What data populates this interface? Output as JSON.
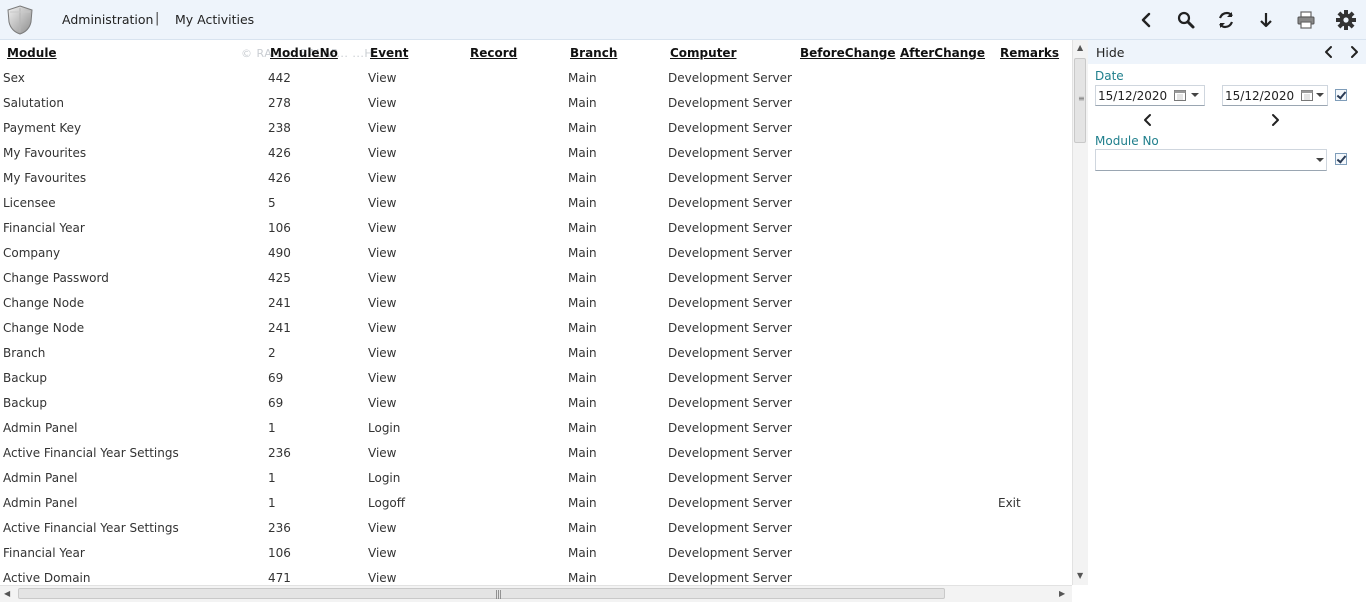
{
  "header": {
    "breadcrumb": [
      "Administration",
      "My Activities"
    ],
    "separator": "|"
  },
  "toolbar": {
    "icons": [
      "back-icon",
      "search-icon",
      "refresh-icon",
      "download-icon",
      "print-icon",
      "settings-icon"
    ]
  },
  "grid": {
    "watermark": "© RA... ...BALAP... ...H",
    "columns": [
      "Module",
      "ModuleNo",
      "Event",
      "Record",
      "Branch",
      "Computer",
      "BeforeChange",
      "AfterChange",
      "Remarks"
    ],
    "rows": [
      {
        "module": "Sex",
        "module_no": "442",
        "event": "View",
        "branch": "Main",
        "computer": "Development Server",
        "remarks": ""
      },
      {
        "module": "Salutation",
        "module_no": "278",
        "event": "View",
        "branch": "Main",
        "computer": "Development Server",
        "remarks": ""
      },
      {
        "module": "Payment Key",
        "module_no": "238",
        "event": "View",
        "branch": "Main",
        "computer": "Development Server",
        "remarks": ""
      },
      {
        "module": "My Favourites",
        "module_no": "426",
        "event": "View",
        "branch": "Main",
        "computer": "Development Server",
        "remarks": ""
      },
      {
        "module": "My Favourites",
        "module_no": "426",
        "event": "View",
        "branch": "Main",
        "computer": "Development Server",
        "remarks": ""
      },
      {
        "module": "Licensee",
        "module_no": "5",
        "event": "View",
        "branch": "Main",
        "computer": "Development Server",
        "remarks": ""
      },
      {
        "module": "Financial Year",
        "module_no": "106",
        "event": "View",
        "branch": "Main",
        "computer": "Development Server",
        "remarks": ""
      },
      {
        "module": "Company",
        "module_no": "490",
        "event": "View",
        "branch": "Main",
        "computer": "Development Server",
        "remarks": ""
      },
      {
        "module": "Change Password",
        "module_no": "425",
        "event": "View",
        "branch": "Main",
        "computer": "Development Server",
        "remarks": ""
      },
      {
        "module": "Change Node",
        "module_no": "241",
        "event": "View",
        "branch": "Main",
        "computer": "Development Server",
        "remarks": ""
      },
      {
        "module": "Change Node",
        "module_no": "241",
        "event": "View",
        "branch": "Main",
        "computer": "Development Server",
        "remarks": ""
      },
      {
        "module": "Branch",
        "module_no": "2",
        "event": "View",
        "branch": "Main",
        "computer": "Development Server",
        "remarks": ""
      },
      {
        "module": "Backup",
        "module_no": "69",
        "event": "View",
        "branch": "Main",
        "computer": "Development Server",
        "remarks": ""
      },
      {
        "module": "Backup",
        "module_no": "69",
        "event": "View",
        "branch": "Main",
        "computer": "Development Server",
        "remarks": ""
      },
      {
        "module": "Admin Panel",
        "module_no": "1",
        "event": "Login",
        "branch": "Main",
        "computer": "Development Server",
        "remarks": ""
      },
      {
        "module": "Active Financial Year Settings",
        "module_no": "236",
        "event": "View",
        "branch": "Main",
        "computer": "Development Server",
        "remarks": ""
      },
      {
        "module": "Admin Panel",
        "module_no": "1",
        "event": "Login",
        "branch": "Main",
        "computer": "Development Server",
        "remarks": ""
      },
      {
        "module": "Admin Panel",
        "module_no": "1",
        "event": "Logoff",
        "branch": "Main",
        "computer": "Development Server",
        "remarks": "Exit"
      },
      {
        "module": "Active Financial Year Settings",
        "module_no": "236",
        "event": "View",
        "branch": "Main",
        "computer": "Development Server",
        "remarks": ""
      },
      {
        "module": "Financial Year",
        "module_no": "106",
        "event": "View",
        "branch": "Main",
        "computer": "Development Server",
        "remarks": ""
      },
      {
        "module": "Active Domain",
        "module_no": "471",
        "event": "View",
        "branch": "Main",
        "computer": "Development Server",
        "remarks": ""
      }
    ]
  },
  "filter_panel": {
    "title": "Hide",
    "date_label": "Date",
    "date_from": "15/12/2020",
    "date_to": "15/12/2020",
    "date_checked": true,
    "module_label": "Module No",
    "module_value": "",
    "module_checked": true
  }
}
